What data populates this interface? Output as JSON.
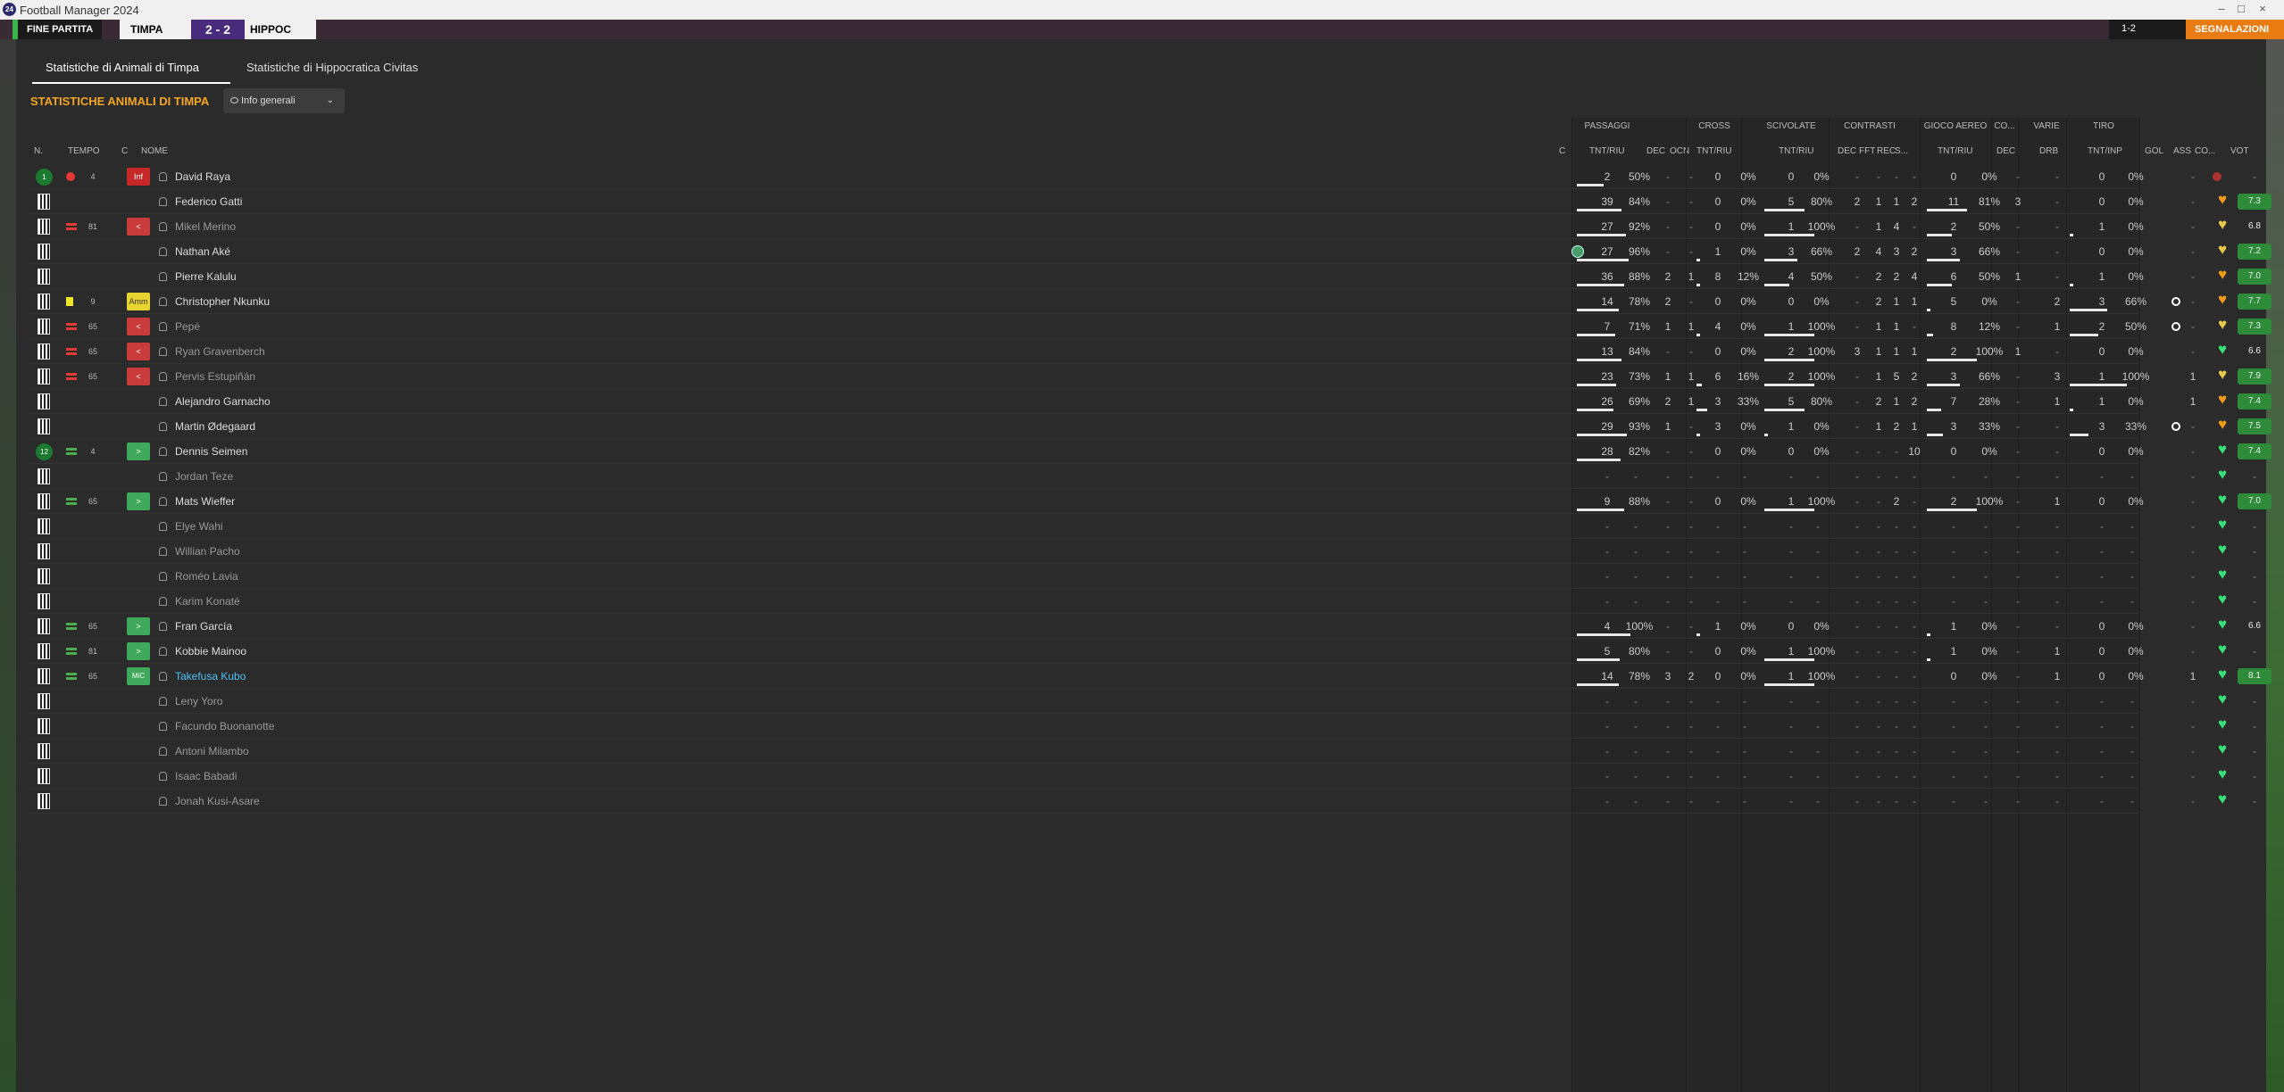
{
  "window": {
    "title": "Football Manager 2024",
    "minimize": "–",
    "maximize": "□",
    "close": "×"
  },
  "scorebar": {
    "end_match": "FINE PARTITA",
    "team_a": "TIMPA",
    "score": "2 - 2",
    "team_b": "HIPPOC",
    "time": "1-2",
    "right_label": "SEGNALAZIONI"
  },
  "tabs": [
    "Statistiche di Animali di Timpa",
    "Statistiche di Hippocratica Civitas"
  ],
  "title": "STATISTICHE ANIMALI DI TIMPA",
  "filter": {
    "label": "Info generali"
  },
  "groups": [
    "PASSAGGI",
    "CROSS",
    "SCIVOLATE",
    "CONTRASTI",
    "GIOCO AEREO",
    "CO...",
    "VARIE",
    "TIRO"
  ],
  "headers": [
    "N.",
    "TEMPO",
    "C",
    "NOME",
    "C",
    "TNT/RIU",
    "DEC",
    "OCN",
    "TNT/RIU",
    "TNT/RIU",
    "DEC",
    "FFT",
    "REC",
    "S...",
    "TNT/RIU",
    "DEC",
    "DRB",
    "TNT/INP",
    "GOL",
    "ASS",
    "CO...",
    "VOT"
  ],
  "players": [
    {
      "name": "David Raya",
      "pos": "1",
      "evt": "inj",
      "min": "4",
      "badge": "Inf",
      "bt": "inf",
      "pa": "2",
      "pp": "50%",
      "pdec": "-",
      "pocn": "-",
      "ca": "0",
      "cp": "0%",
      "sa": "0",
      "sp": "0%",
      "cdec": "-",
      "fft": "-",
      "rec": "-",
      "s": "-",
      "ga": "0",
      "gp": "0%",
      "codec": "-",
      "drb": "-",
      "ta": "0",
      "tp": "0%",
      "gol": "",
      "ass": "-",
      "heart": "red",
      "vot": "-"
    },
    {
      "name": "Federico Gatti",
      "pa": "39",
      "pp": "84%",
      "pdec": "-",
      "pocn": "-",
      "ca": "0",
      "cp": "0%",
      "sa": "5",
      "sp": "80%",
      "cdec": "2",
      "fft": "1",
      "rec": "1",
      "s": "2",
      "ga": "11",
      "gp": "81%",
      "codec": "3",
      "drb": "-",
      "ta": "0",
      "tp": "0%",
      "gol": "",
      "ass": "-",
      "heart": "orange",
      "vot": "7.3"
    },
    {
      "name": "Mikel Merino",
      "evt": "sub",
      "min": "81",
      "badge": "<",
      "bt": "out",
      "dim": true,
      "pa": "27",
      "pp": "92%",
      "pdec": "-",
      "pocn": "-",
      "ca": "0",
      "cp": "0%",
      "sa": "1",
      "sp": "100%",
      "cdec": "-",
      "fft": "1",
      "rec": "4",
      "s": "-",
      "ga": "2",
      "gp": "50%",
      "codec": "-",
      "drb": "-",
      "ta": "1",
      "tp": "0%",
      "gol": "",
      "ass": "-",
      "heart": "yellow",
      "vot": "6.8"
    },
    {
      "name": "Nathan Aké",
      "capt": true,
      "pa": "27",
      "pp": "96%",
      "pdec": "-",
      "pocn": "-",
      "ca": "1",
      "cp": "0%",
      "sa": "3",
      "sp": "66%",
      "cdec": "2",
      "fft": "4",
      "rec": "3",
      "s": "2",
      "ga": "3",
      "gp": "66%",
      "codec": "-",
      "drb": "-",
      "ta": "0",
      "tp": "0%",
      "gol": "",
      "ass": "-",
      "heart": "yellow",
      "vot": "7.2"
    },
    {
      "name": "Pierre Kalulu",
      "pa": "36",
      "pp": "88%",
      "pdec": "2",
      "pocn": "1",
      "ca": "8",
      "cp": "12%",
      "sa": "4",
      "sp": "50%",
      "cdec": "-",
      "fft": "2",
      "rec": "2",
      "s": "4",
      "ga": "6",
      "gp": "50%",
      "codec": "1",
      "drb": "-",
      "ta": "1",
      "tp": "0%",
      "gol": "",
      "ass": "-",
      "heart": "orange",
      "vot": "7.0"
    },
    {
      "name": "Christopher Nkunku",
      "evt": "yc",
      "min": "9",
      "badge": "Amm",
      "bt": "amm",
      "pa": "14",
      "pp": "78%",
      "pdec": "2",
      "pocn": "-",
      "ca": "0",
      "cp": "0%",
      "sa": "0",
      "sp": "0%",
      "cdec": "-",
      "fft": "2",
      "rec": "1",
      "s": "1",
      "ga": "5",
      "gp": "0%",
      "codec": "-",
      "drb": "2",
      "ta": "3",
      "tp": "66%",
      "gol": "ball",
      "ass": "-",
      "heart": "orange",
      "vot": "7.7"
    },
    {
      "name": "Pepé",
      "evt": "sub",
      "min": "65",
      "badge": "<",
      "bt": "out",
      "dim": true,
      "pa": "7",
      "pp": "71%",
      "pdec": "1",
      "pocn": "1",
      "ca": "4",
      "cp": "0%",
      "sa": "1",
      "sp": "100%",
      "cdec": "-",
      "fft": "1",
      "rec": "1",
      "s": "-",
      "ga": "8",
      "gp": "12%",
      "codec": "-",
      "drb": "1",
      "ta": "2",
      "tp": "50%",
      "gol": "ball",
      "ass": "-",
      "heart": "yellow",
      "vot": "7.3"
    },
    {
      "name": "Ryan Gravenberch",
      "evt": "sub",
      "min": "65",
      "badge": "<",
      "bt": "out",
      "dim": true,
      "pa": "13",
      "pp": "84%",
      "pdec": "-",
      "pocn": "-",
      "ca": "0",
      "cp": "0%",
      "sa": "2",
      "sp": "100%",
      "cdec": "3",
      "fft": "1",
      "rec": "1",
      "s": "1",
      "ga": "2",
      "gp": "100%",
      "codec": "1",
      "drb": "-",
      "ta": "0",
      "tp": "0%",
      "gol": "",
      "ass": "-",
      "heart": "green",
      "vot": "6.6"
    },
    {
      "name": "Pervis Estupiñán",
      "evt": "sub",
      "min": "65",
      "badge": "<",
      "bt": "out",
      "dim": true,
      "pa": "23",
      "pp": "73%",
      "pdec": "1",
      "pocn": "1",
      "ca": "6",
      "cp": "16%",
      "sa": "2",
      "sp": "100%",
      "cdec": "-",
      "fft": "1",
      "rec": "5",
      "s": "2",
      "ga": "3",
      "gp": "66%",
      "codec": "-",
      "drb": "3",
      "ta": "1",
      "tp": "100%",
      "gol": "",
      "ass": "1",
      "heart": "yellow",
      "vot": "7.9"
    },
    {
      "name": "Alejandro Garnacho",
      "pa": "26",
      "pp": "69%",
      "pdec": "2",
      "pocn": "1",
      "ca": "3",
      "cp": "33%",
      "sa": "5",
      "sp": "80%",
      "cdec": "-",
      "fft": "2",
      "rec": "1",
      "s": "2",
      "ga": "7",
      "gp": "28%",
      "codec": "-",
      "drb": "1",
      "ta": "1",
      "tp": "0%",
      "gol": "",
      "ass": "1",
      "heart": "orange",
      "vot": "7.4"
    },
    {
      "name": "Martin Ødegaard",
      "pa": "29",
      "pp": "93%",
      "pdec": "1",
      "pocn": "-",
      "ca": "3",
      "cp": "0%",
      "sa": "1",
      "sp": "0%",
      "cdec": "-",
      "fft": "1",
      "rec": "2",
      "s": "1",
      "ga": "3",
      "gp": "33%",
      "codec": "-",
      "drb": "-",
      "ta": "3",
      "tp": "33%",
      "gol": "ball",
      "ass": "-",
      "heart": "orange",
      "vot": "7.5"
    },
    {
      "name": "Dennis Seimen",
      "pos": "12",
      "evt": "subin",
      "min": "4",
      "badge": ">",
      "bt": "in",
      "pa": "28",
      "pp": "82%",
      "pdec": "-",
      "pocn": "-",
      "ca": "0",
      "cp": "0%",
      "sa": "0",
      "sp": "0%",
      "cdec": "-",
      "fft": "-",
      "rec": "-",
      "s": "10",
      "ga": "0",
      "gp": "0%",
      "codec": "-",
      "drb": "-",
      "ta": "0",
      "tp": "0%",
      "gol": "",
      "ass": "-",
      "heart": "green",
      "vot": "7.4"
    },
    {
      "name": "Jordan Teze",
      "dim": true,
      "empty": true,
      "heart": "green"
    },
    {
      "name": "Mats Wieffer",
      "evt": "subin",
      "min": "65",
      "badge": ">",
      "bt": "in",
      "pa": "9",
      "pp": "88%",
      "pdec": "-",
      "pocn": "-",
      "ca": "0",
      "cp": "0%",
      "sa": "1",
      "sp": "100%",
      "cdec": "-",
      "fft": "-",
      "rec": "2",
      "s": "-",
      "ga": "2",
      "gp": "100%",
      "codec": "-",
      "drb": "1",
      "ta": "0",
      "tp": "0%",
      "gol": "",
      "ass": "-",
      "heart": "green",
      "vot": "7.0"
    },
    {
      "name": "Elye Wahi",
      "dim": true,
      "empty": true,
      "heart": "green"
    },
    {
      "name": "Willian Pacho",
      "dim": true,
      "empty": true,
      "heart": "green"
    },
    {
      "name": "Roméo Lavia",
      "dim": true,
      "empty": true,
      "heart": "green"
    },
    {
      "name": "Karim Konaté",
      "dim": true,
      "empty": true,
      "heart": "green"
    },
    {
      "name": "Fran García",
      "evt": "subin",
      "min": "65",
      "badge": ">",
      "bt": "in",
      "pa": "4",
      "pp": "100%",
      "pdec": "-",
      "pocn": "-",
      "ca": "1",
      "cp": "0%",
      "sa": "0",
      "sp": "0%",
      "cdec": "-",
      "fft": "-",
      "rec": "-",
      "s": "-",
      "ga": "1",
      "gp": "0%",
      "codec": "-",
      "drb": "-",
      "ta": "0",
      "tp": "0%",
      "gol": "",
      "ass": "-",
      "heart": "green",
      "vot": "6.6"
    },
    {
      "name": "Kobbie Mainoo",
      "evt": "subin",
      "min": "81",
      "badge": ">",
      "bt": "in",
      "pa": "5",
      "pp": "80%",
      "pdec": "-",
      "pocn": "-",
      "ca": "0",
      "cp": "0%",
      "sa": "1",
      "sp": "100%",
      "cdec": "-",
      "fft": "-",
      "rec": "-",
      "s": "-",
      "ga": "1",
      "gp": "0%",
      "codec": "-",
      "drb": "1",
      "ta": "0",
      "tp": "0%",
      "gol": "",
      "ass": "-",
      "heart": "green",
      "vot": "-"
    },
    {
      "name": "Takefusa Kubo",
      "hi": true,
      "evt": "subin",
      "min": "65",
      "badge": "MiC",
      "bt": "mic",
      "pa": "14",
      "pp": "78%",
      "pdec": "3",
      "pocn": "2",
      "ca": "0",
      "cp": "0%",
      "sa": "1",
      "sp": "100%",
      "cdec": "-",
      "fft": "-",
      "rec": "-",
      "s": "-",
      "ga": "0",
      "gp": "0%",
      "codec": "-",
      "drb": "1",
      "ta": "0",
      "tp": "0%",
      "gol": "",
      "ass": "1",
      "heart": "green",
      "vot": "8.1"
    },
    {
      "name": "Leny Yoro",
      "dim": true,
      "empty": true,
      "heart": "green"
    },
    {
      "name": "Facundo Buonanotte",
      "dim": true,
      "empty": true,
      "heart": "green"
    },
    {
      "name": "Antoni Milambo",
      "dim": true,
      "empty": true,
      "heart": "green"
    },
    {
      "name": "Isaac Babadi",
      "dim": true,
      "empty": true,
      "heart": "green"
    },
    {
      "name": "Jonah Kusi-Asare",
      "dim": true,
      "empty": true,
      "heart": "green"
    }
  ]
}
